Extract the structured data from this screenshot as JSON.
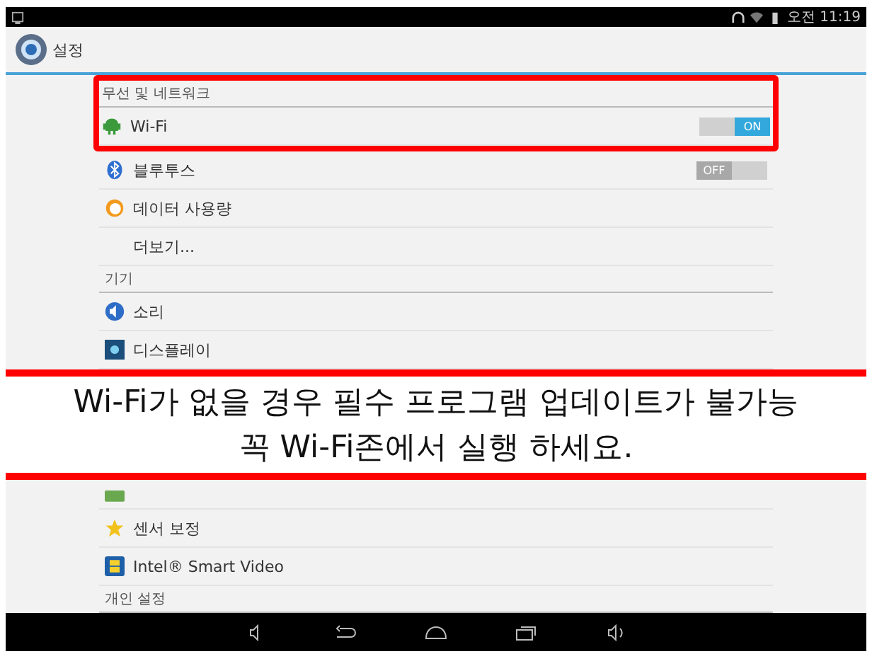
{
  "status_bar": {
    "time": "오전 11:19"
  },
  "action_bar": {
    "title": "설정"
  },
  "highlight_box": {
    "rows": [
      {
        "kind": "header",
        "label": "무선 및 네트워크"
      },
      {
        "kind": "item",
        "label": "Wi-Fi",
        "toggle": {
          "on": true,
          "label": "ON"
        }
      }
    ]
  },
  "rows": [
    {
      "kind": "item",
      "label": "블루투스",
      "toggle": {
        "on": false,
        "label": "OFF"
      }
    },
    {
      "kind": "item",
      "label": "데이터 사용량"
    },
    {
      "kind": "item",
      "label": "더보기..."
    },
    {
      "kind": "header",
      "label": "기기"
    },
    {
      "kind": "item",
      "label": "소리"
    },
    {
      "kind": "item",
      "label": "디스플레이"
    },
    {
      "kind": "notice",
      "lines": [
        "Wi-Fi가 없을 경우 필수 프로그램 업데이트가 불가능",
        "꼭 Wi-Fi존에서 실행 하세요."
      ]
    },
    {
      "kind": "partial"
    },
    {
      "kind": "item",
      "label": "센서 보정"
    },
    {
      "kind": "item",
      "label": "Intel® Smart Video"
    },
    {
      "kind": "header",
      "label": "개인 설정"
    }
  ]
}
